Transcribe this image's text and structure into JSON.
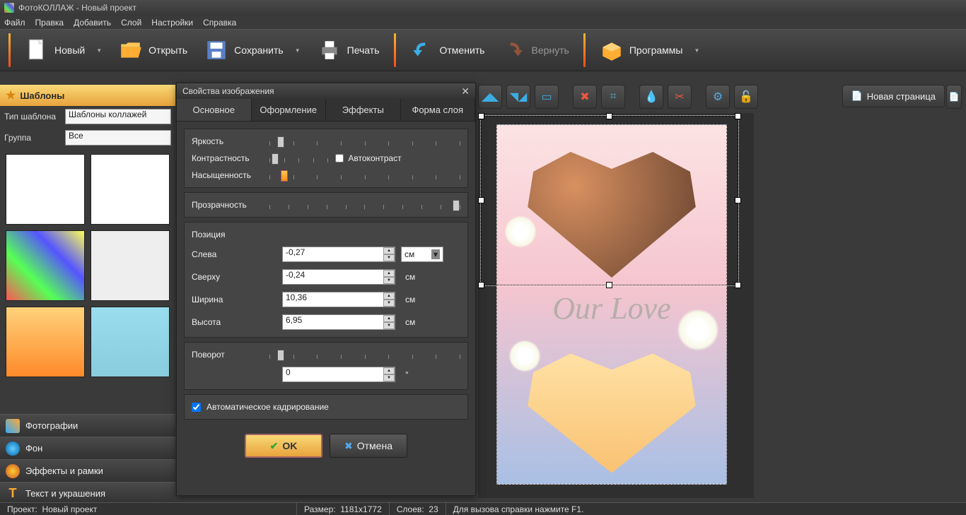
{
  "title": "ФотоКОЛЛАЖ - Новый проект",
  "menu": [
    "Файл",
    "Правка",
    "Добавить",
    "Слой",
    "Настройки",
    "Справка"
  ],
  "toolbar": {
    "new": "Новый",
    "open": "Открыть",
    "save": "Сохранить",
    "print": "Печать",
    "undo": "Отменить",
    "redo": "Вернуть",
    "programs": "Программы"
  },
  "new_page": "Новая страница",
  "left": {
    "templates_header": "Шаблоны",
    "type_label": "Тип шаблона",
    "type_value": "Шаблоны коллажей",
    "group_label": "Группа",
    "group_value": "Все",
    "tabs": {
      "photos": "Фотографии",
      "background": "Фон",
      "effects": "Эффекты и рамки",
      "text": "Текст и украшения"
    }
  },
  "dialog": {
    "title": "Свойства изображения",
    "tabs": [
      "Основное",
      "Оформление",
      "Эффекты",
      "Форма слоя"
    ],
    "brightness": "Яркость",
    "contrast": "Контрастность",
    "saturation": "Насыщенность",
    "autocontrast": "Автоконтраст",
    "opacity": "Прозрачность",
    "position_header": "Позиция",
    "left_label": "Слева",
    "top_label": "Сверху",
    "width_label": "Ширина",
    "height_label": "Высота",
    "rotation": "Поворот",
    "unit": "см",
    "deg": "°",
    "left_val": "-0,27",
    "top_val": "-0,24",
    "width_val": "10,36",
    "height_val": "6,95",
    "rot_val": "0",
    "auto_crop": "Автоматическое кадрирование",
    "ok": "OK",
    "cancel": "Отмена"
  },
  "canvas_text": "Our Love",
  "status": {
    "project_label": "Проект:",
    "project_value": "Новый проект",
    "size_label": "Размер:",
    "size_value": "1181x1772",
    "layers_label": "Слоев:",
    "layers_value": "23",
    "hint": "Для вызова справки нажмите F1."
  }
}
